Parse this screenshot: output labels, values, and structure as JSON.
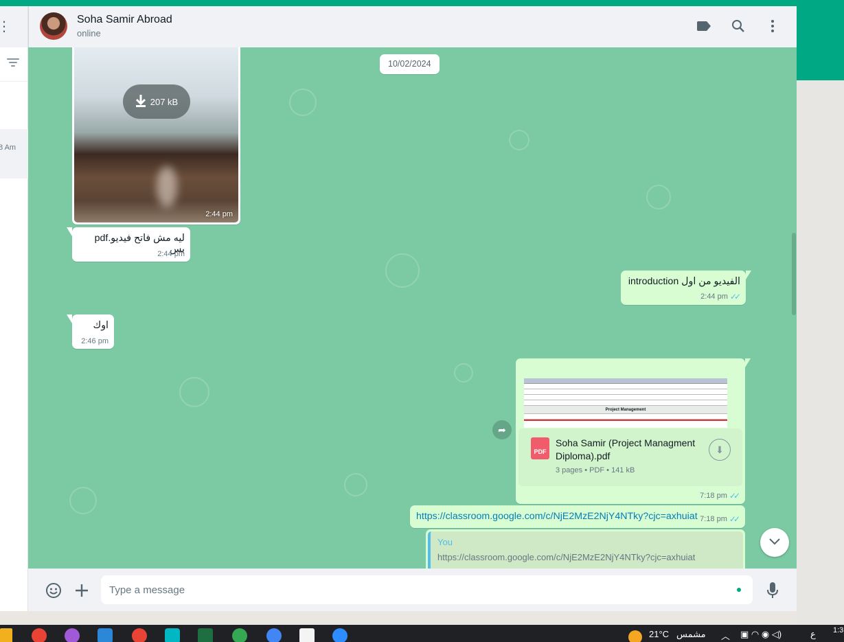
{
  "header": {
    "contact_name": "Soha Samir Abroad",
    "contact_status": "online",
    "icons": [
      "label-icon",
      "search-icon",
      "menu-icon"
    ]
  },
  "sidebar": {
    "chat_time": "8 Am"
  },
  "date_divider": "10/02/2024",
  "messages": [
    {
      "type": "image",
      "direction": "in",
      "download_size": "207 kB",
      "time": "2:44 pm"
    },
    {
      "type": "text",
      "direction": "in",
      "text": "ليه مش فاتح فيديو.pdf بس",
      "time": "2:44 pm"
    },
    {
      "type": "text",
      "direction": "out",
      "text": "الفيديو من اول introduction",
      "time": "2:44 pm",
      "status": "read"
    },
    {
      "type": "text",
      "direction": "in",
      "text": "اوك",
      "time": "2:46 pm"
    },
    {
      "type": "document",
      "direction": "out",
      "file_name": "Soha Samir (Project Managment Diploma).pdf",
      "file_info": "3 pages • PDF • 141 kB",
      "file_badge": "PDF",
      "preview_heading": "Project Management",
      "time": "7:18 pm",
      "status": "read"
    },
    {
      "type": "link",
      "direction": "out",
      "text": "https://classroom.google.com/c/NjE2MzE2NjY4NTky?cjc=axhuiat",
      "time": "7:18 pm",
      "status": "read"
    },
    {
      "type": "reply",
      "direction": "out",
      "quoted_author": "You",
      "quoted_text": "https://classroom.google.com/c/NjE2MzE2NjY4NTky?cjc=axhuiat"
    }
  ],
  "composer": {
    "placeholder": "Type a message"
  },
  "taskbar": {
    "weather_temp": "21°C",
    "weather_text": "مشمس",
    "time": "1:3",
    "lang": "ع"
  },
  "colors": {
    "brand": "#00a884",
    "chat_bg": "#7ccaa4",
    "outgoing": "#d9fdd3",
    "incoming": "#ffffff",
    "read_ticks": "#53bdeb",
    "link": "#027eb5"
  }
}
